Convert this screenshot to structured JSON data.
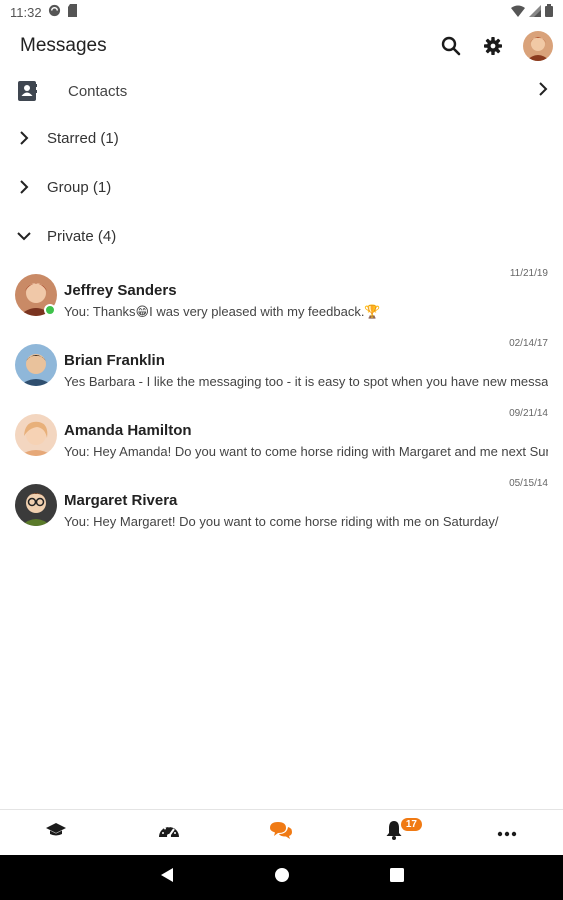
{
  "status_bar": {
    "time": "11:32"
  },
  "app_bar": {
    "title": "Messages"
  },
  "contacts": {
    "label": "Contacts"
  },
  "groups": [
    {
      "label": "Starred (1)",
      "expanded": false
    },
    {
      "label": "Group (1)",
      "expanded": false
    },
    {
      "label": "Private (4)",
      "expanded": true
    }
  ],
  "conversations": [
    {
      "name": "Jeffrey Sanders",
      "date": "11/21/19",
      "message": "You: Thanks😁I was very pleased with my feedback.🏆",
      "online": true
    },
    {
      "name": "Brian Franklin",
      "date": "02/14/17",
      "message": "Yes Barbara - I like the messaging too - it is easy to spot when you have new messa",
      "online": false
    },
    {
      "name": "Amanda Hamilton",
      "date": "09/21/14",
      "message": "You: Hey Amanda! Do you want to come horse riding with Margaret and me next Sur",
      "online": false
    },
    {
      "name": "Margaret Rivera",
      "date": "05/15/14",
      "message": "You: Hey Margaret! Do you want to come horse riding with me on Saturday/",
      "online": false
    }
  ],
  "bottom_nav": {
    "notifications_badge": "17"
  },
  "colors": {
    "accent": "#f07a14",
    "online": "#3ec24b",
    "dark_icon": "#1b1b1b"
  }
}
